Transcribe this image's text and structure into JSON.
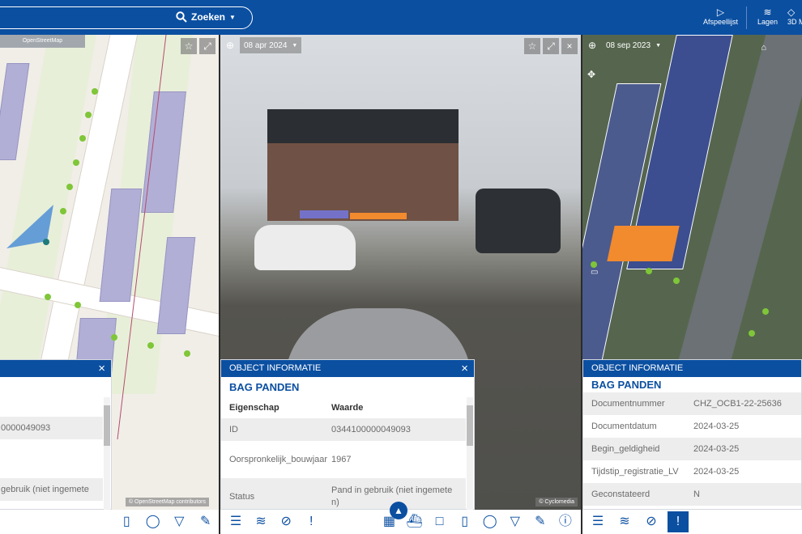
{
  "header": {
    "search": {
      "label": "Zoeken"
    },
    "actions": [
      {
        "label": "Afspeellijst",
        "icon": "play-icon"
      },
      {
        "label": "Lagen",
        "icon": "layers-icon"
      },
      {
        "label": "3D M",
        "icon": "3d-icon"
      }
    ]
  },
  "left_pane": {
    "source_label": "OpenStreetMap",
    "copyright": "© OpenStreetMap contributors",
    "info_panel": {
      "close": "×",
      "rows": [
        {
          "value": "0000049093"
        },
        {
          "value": "gebruik (niet ingemete"
        }
      ]
    }
  },
  "middle_pane": {
    "date": "08 apr 2024",
    "copyright": "© Cyclomedia",
    "info_panel": {
      "header": "OBJECT INFORMATIE",
      "title": "BAG PANDEN",
      "columns": [
        "Eigenschap",
        "Waarde"
      ],
      "rows": [
        {
          "key": "ID",
          "value": "0344100000049093"
        },
        {
          "key": "Oorspronkelijk_bouwjaar",
          "value": "1967"
        },
        {
          "key": "Status",
          "value": "Pand in gebruik (niet ingemete n)"
        }
      ]
    }
  },
  "right_pane": {
    "date": "08 sep 2023",
    "info_panel": {
      "header": "OBJECT INFORMATIE",
      "title": "BAG PANDEN",
      "rows": [
        {
          "key": "Documentnummer",
          "value": "CHZ_OCB1-22-25636"
        },
        {
          "key": "Documentdatum",
          "value": "2024-03-25"
        },
        {
          "key": "Begin_geldigheid",
          "value": "2024-03-25"
        },
        {
          "key": "Tijdstip_registratie_LV",
          "value": "2024-03-25"
        },
        {
          "key": "Geconstateerd",
          "value": "N"
        }
      ]
    }
  },
  "colors": {
    "brand_blue": "#0b4fa1",
    "selected_building": "#f28a2e",
    "tree_green": "#7fc638"
  }
}
